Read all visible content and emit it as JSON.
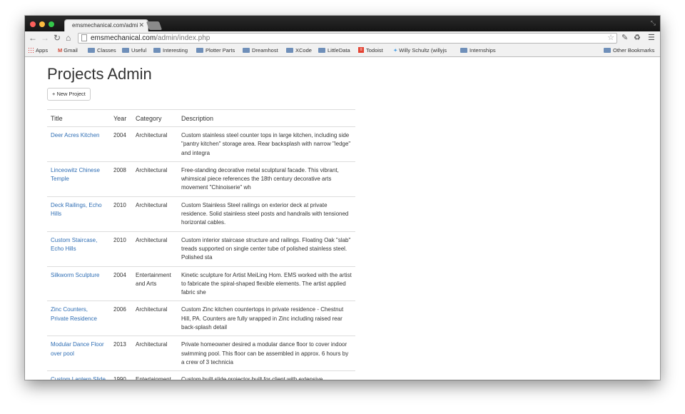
{
  "browser": {
    "tab_title": "emsmechanical.com/admin/",
    "url_host": "emsmechanical.com",
    "url_path": "/admin/index.php"
  },
  "bookmarks": [
    "Apps",
    "Gmail",
    "Classes",
    "Useful",
    "Interesting",
    "Plotter Parts",
    "Dreamhost",
    "XCode",
    "LittleData",
    "Todoist",
    "Willy Schultz (willyjs",
    "Internships"
  ],
  "other_bookmarks": "Other Bookmarks",
  "page": {
    "title": "Projects Admin",
    "new_button": "+ New Project"
  },
  "table": {
    "headers": [
      "Title",
      "Year",
      "Category",
      "Description"
    ],
    "rows": [
      {
        "title": "Deer Acres Kitchen",
        "year": "2004",
        "category": "Architectural",
        "description": "Custom stainless steel counter tops in large kitchen, including side \"pantry kitchen\" storage area. Rear backsplash with narrow \"ledge\" and integra"
      },
      {
        "title": "Linceowitz Chinese Temple",
        "year": "2008",
        "category": "Architectural",
        "description": "Free-standing decorative metal sculptural facade. This vibrant, whimsical piece references the 18th century decorative arts movement \"Chinoiserie\" wh"
      },
      {
        "title": "Deck Railings, Echo Hills",
        "year": "2010",
        "category": "Architectural",
        "description": "Custom Stainless Steel railings on exterior deck at private residence. Solid stainless steel posts and handrails with tensioned horizontal cables."
      },
      {
        "title": "Custom Staircase, Echo Hills",
        "year": "2010",
        "category": "Architectural",
        "description": "Custom interior staircase structure and railings. Floating Oak \"slab\" treads supported on single center tube of polished stainless steel. Polished sta"
      },
      {
        "title": "Silkworm Sculpture",
        "year": "2004",
        "category": "Entertainment and Arts",
        "description": "Kinetic sculpture for Artist MeiLing Hom. EMS worked with the artist to fabricate the spiral-shaped flexible elements. The artist applied fabric she"
      },
      {
        "title": "Zinc Counters, Private Residence",
        "year": "2006",
        "category": "Architectural",
        "description": "Custom Zinc kitchen countertops in private residence - Chestnut Hill, PA. Counters are fully wrapped in Zinc including raised rear back-splash detail"
      },
      {
        "title": "Modular Dance Floor over pool",
        "year": "2013",
        "category": "Architectural",
        "description": "Private homeowner desired a modular dance floor to cover indoor swimming pool. This floor can be assembled in approx. 6 hours by a crew of 3 technicia"
      },
      {
        "title": "Custom Lantern Slide Projector",
        "year": "1990",
        "category": "Entertainment and Arts",
        "description": "Custom built slide projector built for client with extensive"
      }
    ]
  },
  "colors": {
    "link": "#2f6eb4",
    "titlebar": "#1e1e1e",
    "toolbar": "#f1f1f1"
  }
}
